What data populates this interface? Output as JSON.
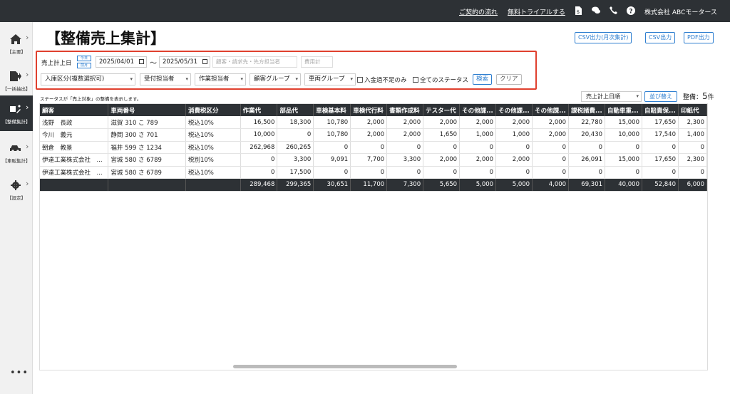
{
  "topbar": {
    "contract_link": "ご契約の流れ",
    "trial_link": "無料トライアルする",
    "company": "株式会社 ABCモータース",
    "icons": [
      "yen-doc-icon",
      "chat-icon",
      "phone-icon",
      "help-icon"
    ]
  },
  "sidebar": {
    "items": [
      {
        "label": "【主要】",
        "icon": "home-icon"
      },
      {
        "label": "【一括抽出】",
        "icon": "export-icon"
      },
      {
        "label": "【整備集計】",
        "icon": "tools-icon"
      },
      {
        "label": "【車販集計】",
        "icon": "car-icon"
      },
      {
        "label": "【設定】",
        "icon": "gear-icon"
      }
    ],
    "more": "•••"
  },
  "page_title": "【整備売上集計】",
  "export": {
    "monthly": "CSV出力(月次集計)",
    "csv": "CSV出力",
    "pdf": "PDF出力"
  },
  "filter": {
    "date_label": "売上計上日",
    "today_btn": "今日",
    "prev_month_btn": "前月",
    "date_from": "2025/04/01",
    "date_to": "2025/05/31",
    "tilde": "〜",
    "customer_placeholder": "顧客・請求先・先方担当者",
    "cost_placeholder": "費用計",
    "entry_type": "入庫区分(複数選択可)",
    "reception": "受付担当者",
    "worker": "作業担当者",
    "customer_group": "顧客グループ",
    "vehicle_group": "車両グループ",
    "unpaid_label": "入金過不足のみ",
    "all_status_label": "全てのステータス",
    "search_btn": "検索",
    "clear_btn": "クリア"
  },
  "status_note": "ステータスが「売上対象」の整備を表示します。",
  "sort": {
    "selected": "売上計上日順",
    "button": "並び替え"
  },
  "count": {
    "label": "整備：",
    "value": "5",
    "unit": "件"
  },
  "table": {
    "headers": [
      "顧客",
      "車両番号",
      "消費税区分",
      "作業代",
      "部品代",
      "車検基本料",
      "車検代行料",
      "書類作成料",
      "テスター代",
      "その他課...",
      "その他課...",
      "その他課...",
      "課税諸費...",
      "自動車重...",
      "自賠責保...",
      "印紙代"
    ],
    "rows": [
      [
        "浅野　長政",
        "滋賀 310 こ 789",
        "税込10%",
        "16,500",
        "18,300",
        "10,780",
        "2,000",
        "2,000",
        "2,000",
        "2,000",
        "2,000",
        "2,000",
        "22,780",
        "15,000",
        "17,650",
        "2,300"
      ],
      [
        "今川　義元",
        "静岡 300 さ 701",
        "税込10%",
        "10,000",
        "0",
        "10,780",
        "2,000",
        "2,000",
        "1,650",
        "1,000",
        "1,000",
        "2,000",
        "20,430",
        "10,000",
        "17,540",
        "1,400"
      ],
      [
        "朝倉　教景",
        "福井 599 さ 1234",
        "税込10%",
        "262,968",
        "260,265",
        "0",
        "0",
        "0",
        "0",
        "0",
        "0",
        "0",
        "0",
        "0",
        "0",
        "0"
      ],
      [
        "伊達工業株式会社　...",
        "宮城 580 さ 6789",
        "税別10%",
        "0",
        "3,300",
        "9,091",
        "7,700",
        "3,300",
        "2,000",
        "2,000",
        "2,000",
        "0",
        "26,091",
        "15,000",
        "17,650",
        "2,300"
      ],
      [
        "伊達工業株式会社　...",
        "宮城 580 さ 6789",
        "税込10%",
        "0",
        "17,500",
        "0",
        "0",
        "0",
        "0",
        "0",
        "0",
        "0",
        "0",
        "0",
        "0",
        "0"
      ]
    ],
    "totals": [
      "",
      "",
      "",
      "289,468",
      "299,365",
      "30,651",
      "11,700",
      "7,300",
      "5,650",
      "5,000",
      "5,000",
      "4,000",
      "69,301",
      "40,000",
      "52,840",
      "6,000"
    ]
  }
}
